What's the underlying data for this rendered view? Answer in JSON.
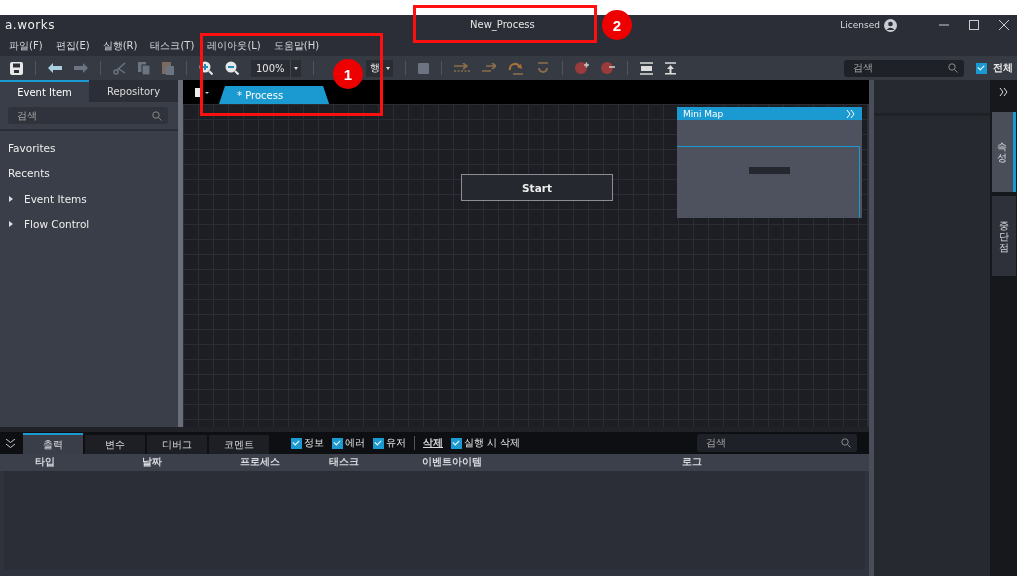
{
  "window": {
    "logo": "a.works",
    "title": "New_Process",
    "license": "Licensed"
  },
  "menu": [
    "파일(F)",
    "편집(E)",
    "실행(R)",
    "태스크(T)",
    "레이아웃(L)",
    "도움말(H)"
  ],
  "toolbar": {
    "zoom": "100%",
    "run_mode": "행",
    "search": {
      "placeholder": "검색"
    },
    "all": {
      "label": "전체",
      "checked": true
    }
  },
  "left_panel": {
    "tabs": [
      {
        "label": "Event Item",
        "selected": true
      },
      {
        "label": "Repository",
        "selected": false
      }
    ],
    "search": {
      "placeholder": "검색"
    },
    "items": [
      {
        "label": "Favorites",
        "kind": "section"
      },
      {
        "label": "Recents",
        "kind": "section"
      },
      {
        "label": "Event Items",
        "kind": "folder",
        "expanded": false
      },
      {
        "label": "Flow Control",
        "kind": "folder",
        "expanded": false
      }
    ]
  },
  "document_tabs": [
    {
      "label": "* Process",
      "selected": true
    }
  ],
  "canvas": {
    "nodes": [
      {
        "label": "Start"
      }
    ],
    "minimap": {
      "title": "Mini Map"
    }
  },
  "right_tabs": [
    {
      "label": "속성",
      "selected": true
    },
    {
      "label": "중단점",
      "selected": false
    }
  ],
  "output": {
    "tabs": [
      {
        "label": "출력",
        "selected": true
      },
      {
        "label": "변수",
        "selected": false
      },
      {
        "label": "디버그",
        "selected": false
      },
      {
        "label": "코멘트",
        "selected": false
      }
    ],
    "filters": [
      {
        "label": "정보",
        "checked": true
      },
      {
        "label": "에러",
        "checked": true
      },
      {
        "label": "유저",
        "checked": true
      }
    ],
    "clear": "삭제",
    "clear_on_run": {
      "label": "실행 시 삭제",
      "checked": true
    },
    "search": {
      "placeholder": "검색"
    },
    "columns": [
      "타입",
      "날짜",
      "프로세스",
      "태스크",
      "이벤트아이템",
      "로그"
    ]
  },
  "annotations": [
    {
      "label": "1"
    },
    {
      "label": "2"
    }
  ]
}
